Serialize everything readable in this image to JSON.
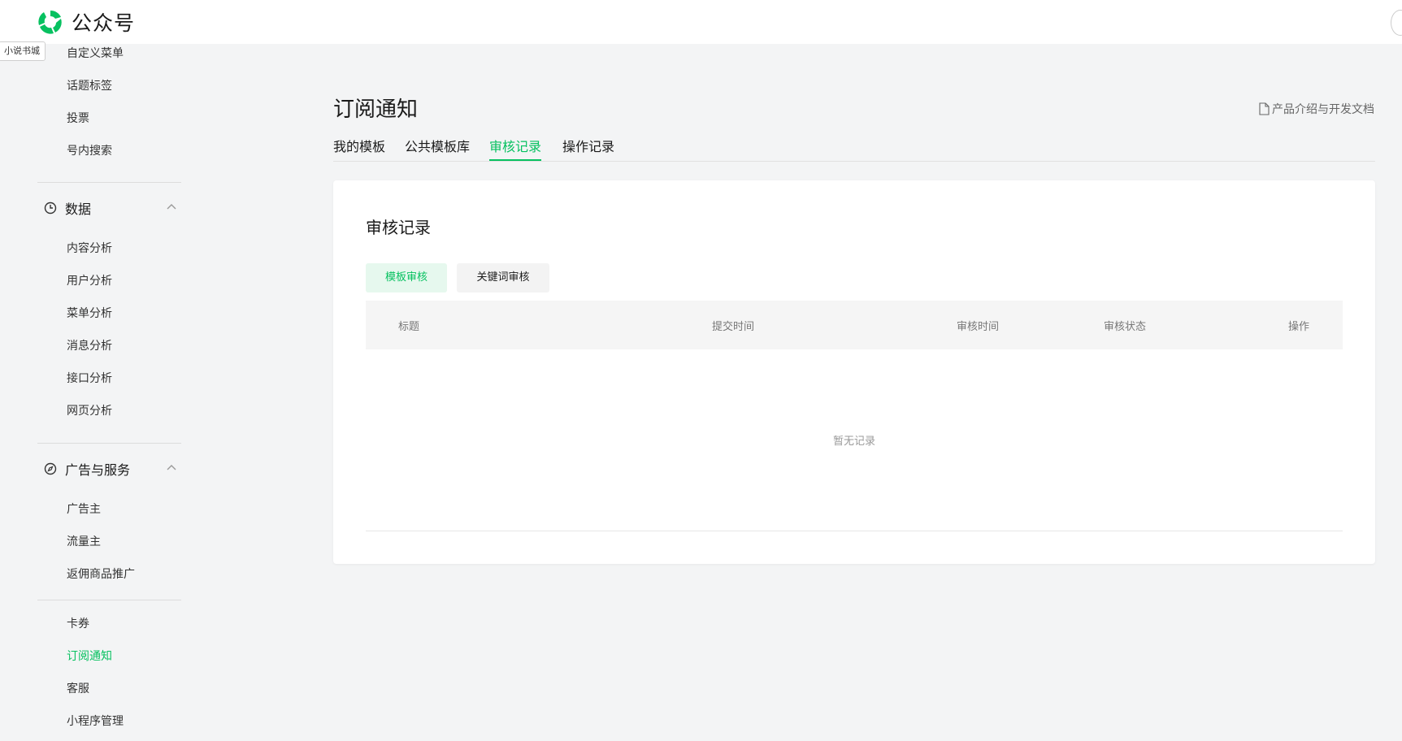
{
  "header": {
    "brand": "公众号"
  },
  "tooltip": {
    "text": "小说书城"
  },
  "sidebar": {
    "top_items": [
      "自定义菜单",
      "话题标签",
      "投票",
      "号内搜索"
    ],
    "groups": [
      {
        "label": "数据",
        "icon": "clock-icon",
        "items": [
          "内容分析",
          "用户分析",
          "菜单分析",
          "消息分析",
          "接口分析",
          "网页分析"
        ]
      },
      {
        "label": "广告与服务",
        "icon": "compass-icon",
        "items": [
          "广告主",
          "流量主",
          "返佣商品推广"
        ]
      }
    ],
    "bottom_items": [
      "卡券",
      "订阅通知",
      "客服",
      "小程序管理"
    ],
    "active_item": "订阅通知"
  },
  "main": {
    "title": "订阅通知",
    "doc_link": "产品介绍与开发文档",
    "tabs": [
      "我的模板",
      "公共模板库",
      "审核记录",
      "操作记录"
    ],
    "active_tab": "审核记录",
    "card": {
      "title": "审核记录",
      "sub_tabs": [
        "模板审核",
        "关键词审核"
      ],
      "columns": [
        "标题",
        "提交时间",
        "审核时间",
        "审核状态",
        "操作"
      ],
      "empty_text": "暂无记录"
    }
  },
  "colors": {
    "accent": "#07c160",
    "background": "#f3f4f5",
    "card": "#ffffff"
  }
}
